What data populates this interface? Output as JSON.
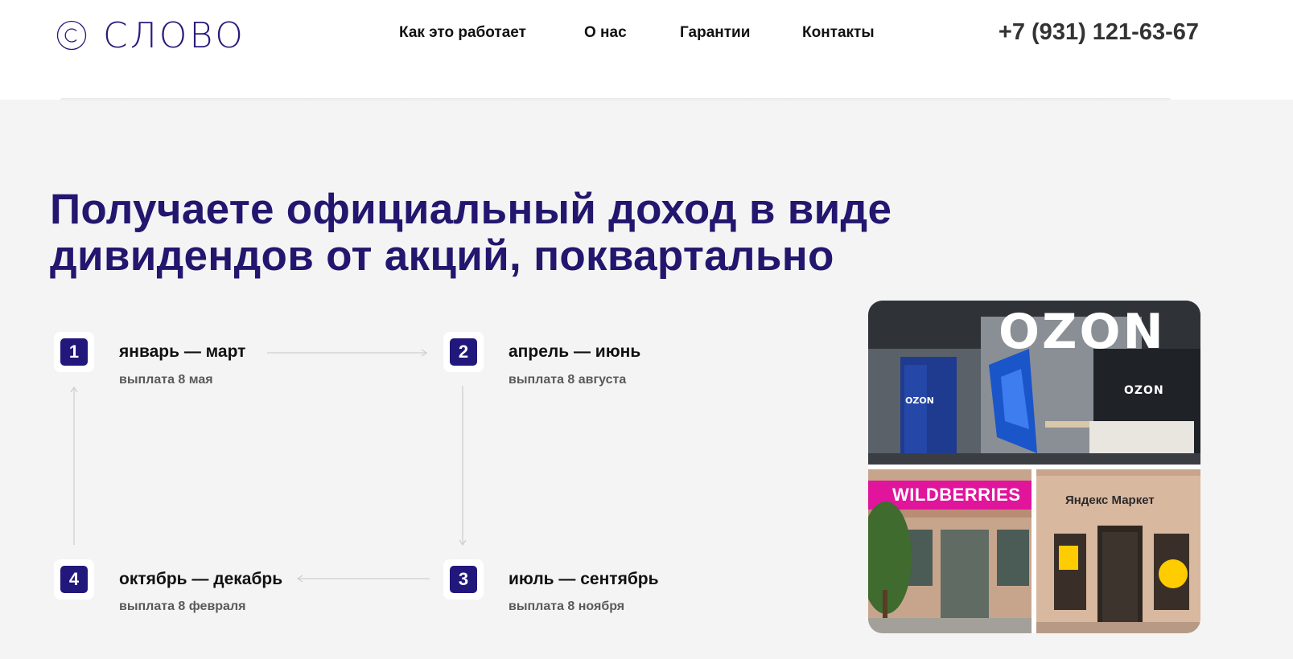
{
  "header": {
    "logo_text": "СЛОВО",
    "nav": [
      {
        "label": "Как это работает"
      },
      {
        "label": "О нас"
      },
      {
        "label": "Гарантии"
      },
      {
        "label": "Контакты"
      }
    ],
    "phone": "+7 (931) 121-63-67"
  },
  "hero": {
    "title_line1": "Получаете официальный доход в виде",
    "title_line2": "дивидендов от акций, поквартально"
  },
  "steps": [
    {
      "num": "1",
      "title": "январь — март",
      "payout": "выплата 8 мая"
    },
    {
      "num": "2",
      "title": "апрель — июнь",
      "payout": "выплата 8 августа"
    },
    {
      "num": "3",
      "title": "июль — сентябрь",
      "payout": "выплата 8 ноября"
    },
    {
      "num": "4",
      "title": "октябрь — декабрь",
      "payout": "выплата 8 февраля"
    }
  ],
  "collage": {
    "ozon_sign": "OZON",
    "ozon_small_sign": "OZON",
    "ozon_locker_sign": "OZON",
    "wildberries_sign": "WILDBERRIES",
    "yandex_sign": "Яндекс Маркет"
  },
  "colors": {
    "accent": "#23166e",
    "badge": "#22177a",
    "background": "#f4f4f4",
    "header_bg": "#ffffff",
    "wildberries": "#cb11ab",
    "yandex_yellow": "#ffcc00"
  },
  "icons": {
    "logo": "copyright-circle-icon",
    "arrows": "thin-arrow-icon"
  }
}
